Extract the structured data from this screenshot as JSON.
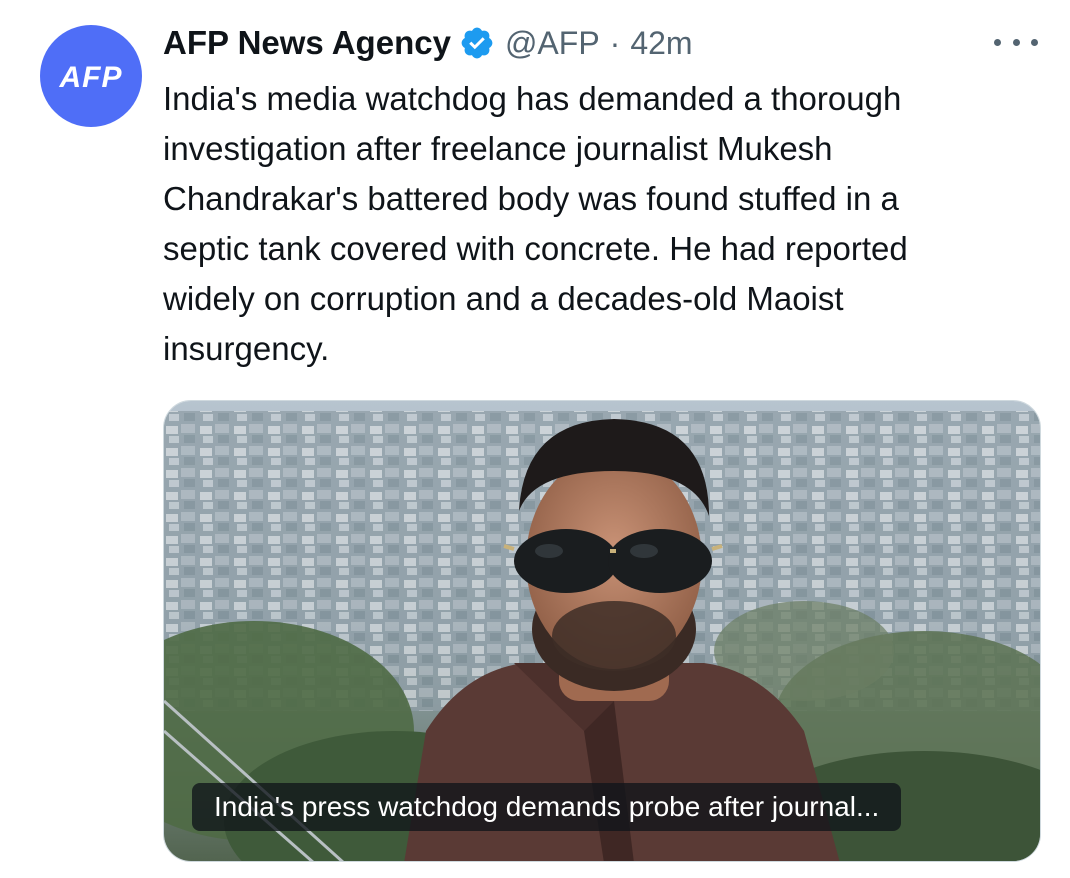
{
  "tweet": {
    "author": {
      "name": "AFP News Agency",
      "handle": "@AFP",
      "separator": "·",
      "time": "42m",
      "avatar_text": "AFP",
      "avatar_color": "#4f6ef7",
      "verified_icon": "verified-badge-icon",
      "verified_color": "#1d9bf0"
    },
    "more_icon": "more-horizontal-icon",
    "text": "India's media watchdog has demanded a thorough\ninvestigation after freelance journalist Mukesh\nChandrakar's battered body was found stuffed in a\nseptic tank covered with concrete. He had reported\nwidely on corruption and a decades-old Maoist\ninsurgency.",
    "link_card": {
      "image": "photo of man wearing sunglasses in front of hillside town",
      "caption": "India's press watchdog demands probe after journal..."
    }
  }
}
